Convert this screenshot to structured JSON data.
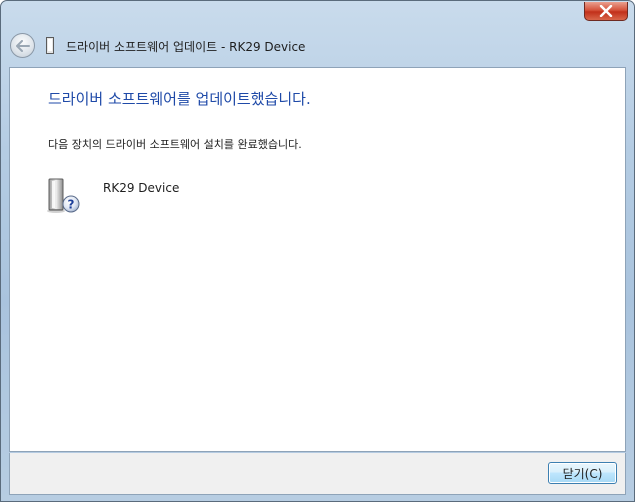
{
  "window": {
    "title": "드라이버 소프트웨어 업데이트 - RK29 Device",
    "close_tooltip_icon": "close-icon"
  },
  "content": {
    "headline": "드라이버 소프트웨어를 업데이트했습니다.",
    "description": "다음 장치의 드라이버 소프트웨어 설치를 완료했습니다.",
    "device": {
      "name": "RK29 Device",
      "icon": "unknown-device-icon"
    }
  },
  "footer": {
    "close_button_label": "닫기(C)"
  },
  "colors": {
    "headline": "#1f4aa8",
    "close_button_red": "#c1301a",
    "button_border": "#3c7fb1"
  }
}
